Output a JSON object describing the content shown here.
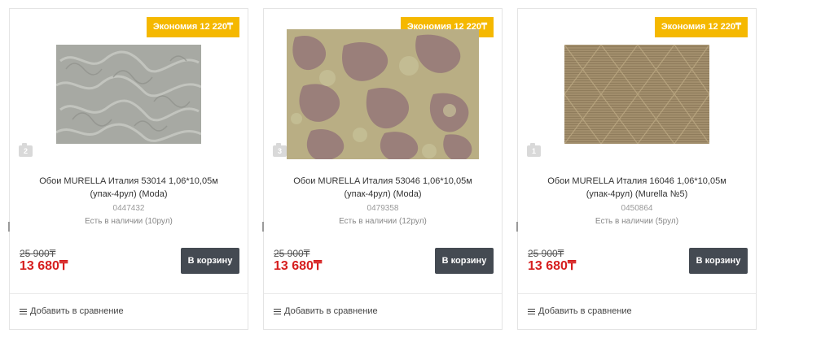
{
  "products": [
    {
      "badge": "Экономия 12 220₸",
      "photo_count": "2",
      "title": "Обои MURELLA Италия 53014 1,06*10,05м (упак-4рул) (Moda)",
      "sku": "0447432",
      "stock": "Есть в наличии (10рул)",
      "old_price": "25 900₸",
      "price": "13 680₸",
      "cart_label": "В корзину",
      "compare_label": "Добавить в сравнение",
      "image_icon": "wallpaper-swatch-gray-floral"
    },
    {
      "badge": "Экономия 12 220₸",
      "photo_count": "3",
      "title": "Обои MURELLA Италия 53046 1,06*10,05м (упак-4рул) (Moda)",
      "sku": "0479358",
      "stock": "Есть в наличии (12рул)",
      "old_price": "25 900₸",
      "price": "13 680₸",
      "cart_label": "В корзину",
      "compare_label": "Добавить в сравнение",
      "image_icon": "wallpaper-swatch-mauve-camouflage"
    },
    {
      "badge": "Экономия 12 220₸",
      "photo_count": "1",
      "title": "Обои MURELLA Италия 16046 1,06*10,05м (упак-4рул) (Murella №5)",
      "sku": "0450864",
      "stock": "Есть в наличии (5рул)",
      "old_price": "25 900₸",
      "price": "13 680₸",
      "cart_label": "В корзину",
      "compare_label": "Добавить в сравнение",
      "image_icon": "wallpaper-swatch-beige-stripes"
    }
  ],
  "colors": {
    "badge": "#f5b800",
    "price": "#d61f1f",
    "button": "#444a52"
  }
}
